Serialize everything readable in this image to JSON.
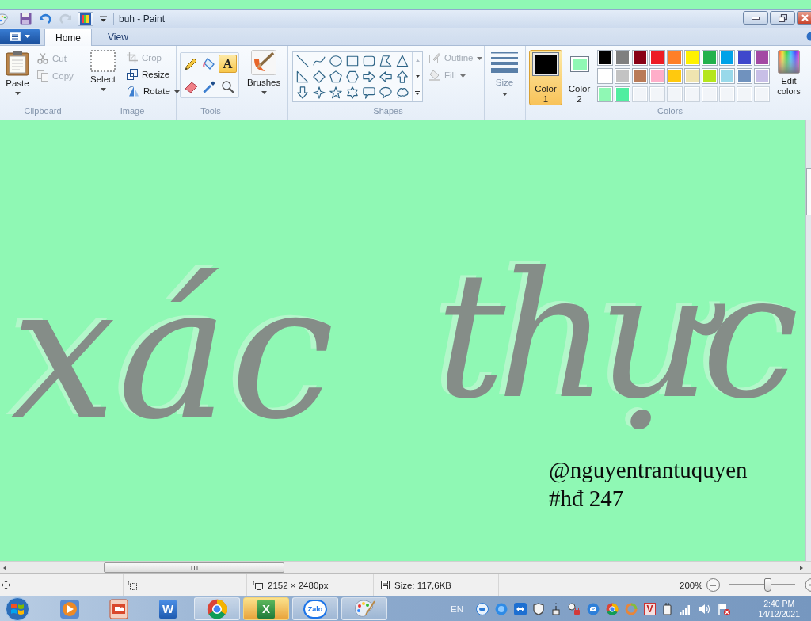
{
  "window": {
    "title": "buh - Paint",
    "quick_access": [
      {
        "kind": "save",
        "disabled": false
      },
      {
        "kind": "undo",
        "disabled": false
      },
      {
        "kind": "redo",
        "disabled": true
      },
      {
        "kind": "colors",
        "disabled": false
      }
    ]
  },
  "tabs": [
    {
      "label": "Home",
      "selected": true
    },
    {
      "label": "View",
      "selected": false
    }
  ],
  "ribbon": {
    "clipboard": {
      "label": "Clipboard",
      "buttons": [
        {
          "kind": "paste",
          "label": "Paste",
          "disabled": false
        },
        {
          "kind": "cut",
          "label": "Cut",
          "disabled": true
        },
        {
          "kind": "copy",
          "label": "Copy",
          "disabled": true
        }
      ]
    },
    "image": {
      "label": "Image",
      "buttons": [
        {
          "kind": "select",
          "label": "Select",
          "disabled": false
        },
        {
          "kind": "crop",
          "label": "Crop",
          "disabled": true
        },
        {
          "kind": "resize",
          "label": "Resize",
          "disabled": false
        },
        {
          "kind": "rotate",
          "label": "Rotate",
          "disabled": false
        }
      ]
    },
    "tools": {
      "label": "Tools",
      "items": [
        {
          "kind": "pencil",
          "selected": false
        },
        {
          "kind": "fill",
          "selected": false
        },
        {
          "kind": "text",
          "glyph": "A",
          "selected": true
        },
        {
          "kind": "eraser",
          "selected": false
        },
        {
          "kind": "picker",
          "selected": false
        },
        {
          "kind": "magnifier",
          "selected": false
        }
      ]
    },
    "brushes": {
      "label": "Brushes"
    },
    "shapes": {
      "label": "Shapes",
      "outline": {
        "label": "Outline",
        "disabled": true
      },
      "fill": {
        "label": "Fill",
        "disabled": true
      }
    },
    "size": {
      "label": "Size"
    },
    "colors": {
      "label": "Colors",
      "selectors": [
        {
          "label": "Color",
          "number": "1",
          "color": "#000000",
          "selected": true
        },
        {
          "label": "Color",
          "number": "2",
          "color": "#8ff8b4",
          "selected": false
        }
      ],
      "palette": [
        {
          "kind": "color",
          "color": "#000000"
        },
        {
          "kind": "color",
          "color": "#7f7f7f"
        },
        {
          "kind": "color",
          "color": "#880015"
        },
        {
          "kind": "color",
          "color": "#ed1c24"
        },
        {
          "kind": "color",
          "color": "#ff7f27"
        },
        {
          "kind": "color",
          "color": "#fff200"
        },
        {
          "kind": "color",
          "color": "#22b14c"
        },
        {
          "kind": "color",
          "color": "#00a2e8"
        },
        {
          "kind": "color",
          "color": "#3f48cc"
        },
        {
          "kind": "color",
          "color": "#a349a4"
        },
        {
          "kind": "color",
          "color": "#ffffff"
        },
        {
          "kind": "color",
          "color": "#c3c3c3"
        },
        {
          "kind": "color",
          "color": "#b97a57"
        },
        {
          "kind": "color",
          "color": "#ffaec9"
        },
        {
          "kind": "color",
          "color": "#ffc90e"
        },
        {
          "kind": "color",
          "color": "#efe4b0"
        },
        {
          "kind": "color",
          "color": "#b5e61d"
        },
        {
          "kind": "color",
          "color": "#99d9ea"
        },
        {
          "kind": "color",
          "color": "#7092be"
        },
        {
          "kind": "color",
          "color": "#c8bfe7"
        },
        {
          "kind": "color",
          "color": "#8ff8b4"
        },
        {
          "kind": "color",
          "color": "#50eea0"
        },
        {
          "kind": "empty"
        },
        {
          "kind": "empty"
        },
        {
          "kind": "empty"
        },
        {
          "kind": "empty"
        },
        {
          "kind": "empty"
        },
        {
          "kind": "empty"
        },
        {
          "kind": "empty"
        },
        {
          "kind": "empty"
        }
      ],
      "edit": {
        "label": "Edit colors"
      }
    }
  },
  "canvas": {
    "lettering": [
      "xác",
      "thực"
    ],
    "text_lines": [
      "@nguyentrantuquyen",
      "#hđ 247"
    ]
  },
  "status_bar": {
    "dimensions": "2152 × 2480px",
    "file_size": "Size: 117,6KB",
    "zoom": "200%",
    "zoom_slider": {
      "level": 0.58
    }
  },
  "taskbar": {
    "apps": [
      {
        "kind": "media",
        "running": false,
        "flashing": false
      },
      {
        "kind": "presentation",
        "running": false,
        "flashing": false
      },
      {
        "kind": "word",
        "glyph": "W",
        "running": false,
        "flashing": false
      },
      {
        "kind": "browser",
        "running": true,
        "flashing": false
      },
      {
        "kind": "excel",
        "glyph": "X",
        "running": true,
        "flashing": true
      },
      {
        "kind": "zalo",
        "glyph": "Zalo",
        "running": true,
        "flashing": false
      },
      {
        "kind": "paint",
        "running": true,
        "flashing": false
      }
    ],
    "language": "EN",
    "tray_badge": "V",
    "time": "2:40 PM",
    "date": "14/12/2021"
  }
}
